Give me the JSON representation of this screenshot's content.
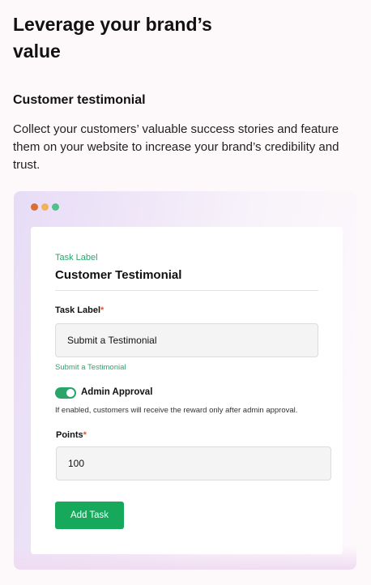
{
  "page": {
    "headline": "Leverage your brand’s value",
    "section_title": "Customer testimonial",
    "description": "Collect your customers’ valuable success stories and feature them on your website to increase your brand’s credibility and trust."
  },
  "window_dots": {
    "colors": [
      "#d96f32",
      "#f0b35a",
      "#4fc28a"
    ]
  },
  "form": {
    "small_label": "Task Label",
    "title": "Customer Testimonial",
    "task_label_field": {
      "label": "Task Label",
      "required_marker": "*",
      "value": "Submit a Testimonial",
      "helper": "Submit a Testimonial"
    },
    "admin_approval": {
      "label": "Admin Approval",
      "enabled": true,
      "help": "If enabled, customers will receive the reward only after admin approval."
    },
    "points_field": {
      "label": "Points",
      "required_marker": "*",
      "value": "100"
    },
    "submit_label": "Add Task"
  },
  "colors": {
    "accent_green": "#16a85b",
    "required_red": "#e0542f"
  }
}
